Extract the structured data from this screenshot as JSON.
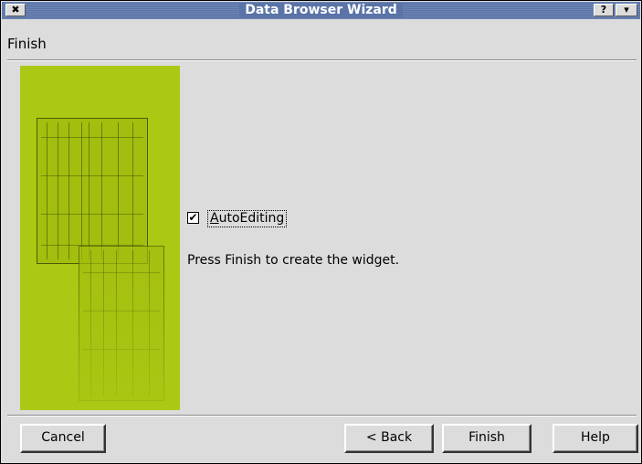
{
  "window": {
    "title": "Data Browser Wizard",
    "close_glyph": "✖",
    "help_glyph": "?",
    "menu_glyph": "▾"
  },
  "page": {
    "heading": "Finish",
    "message": "Press Finish to create the widget."
  },
  "autoediting": {
    "label_prefix": "A",
    "label_rest": "utoEditing",
    "checked": true,
    "check_glyph": "✔"
  },
  "buttons": {
    "cancel": "Cancel",
    "back": "< Back",
    "finish": "Finish",
    "help": "Help"
  },
  "colors": {
    "title_bar": "#5a74a8",
    "side_panel": "#aac814",
    "window_bg": "#dcdcdc"
  }
}
